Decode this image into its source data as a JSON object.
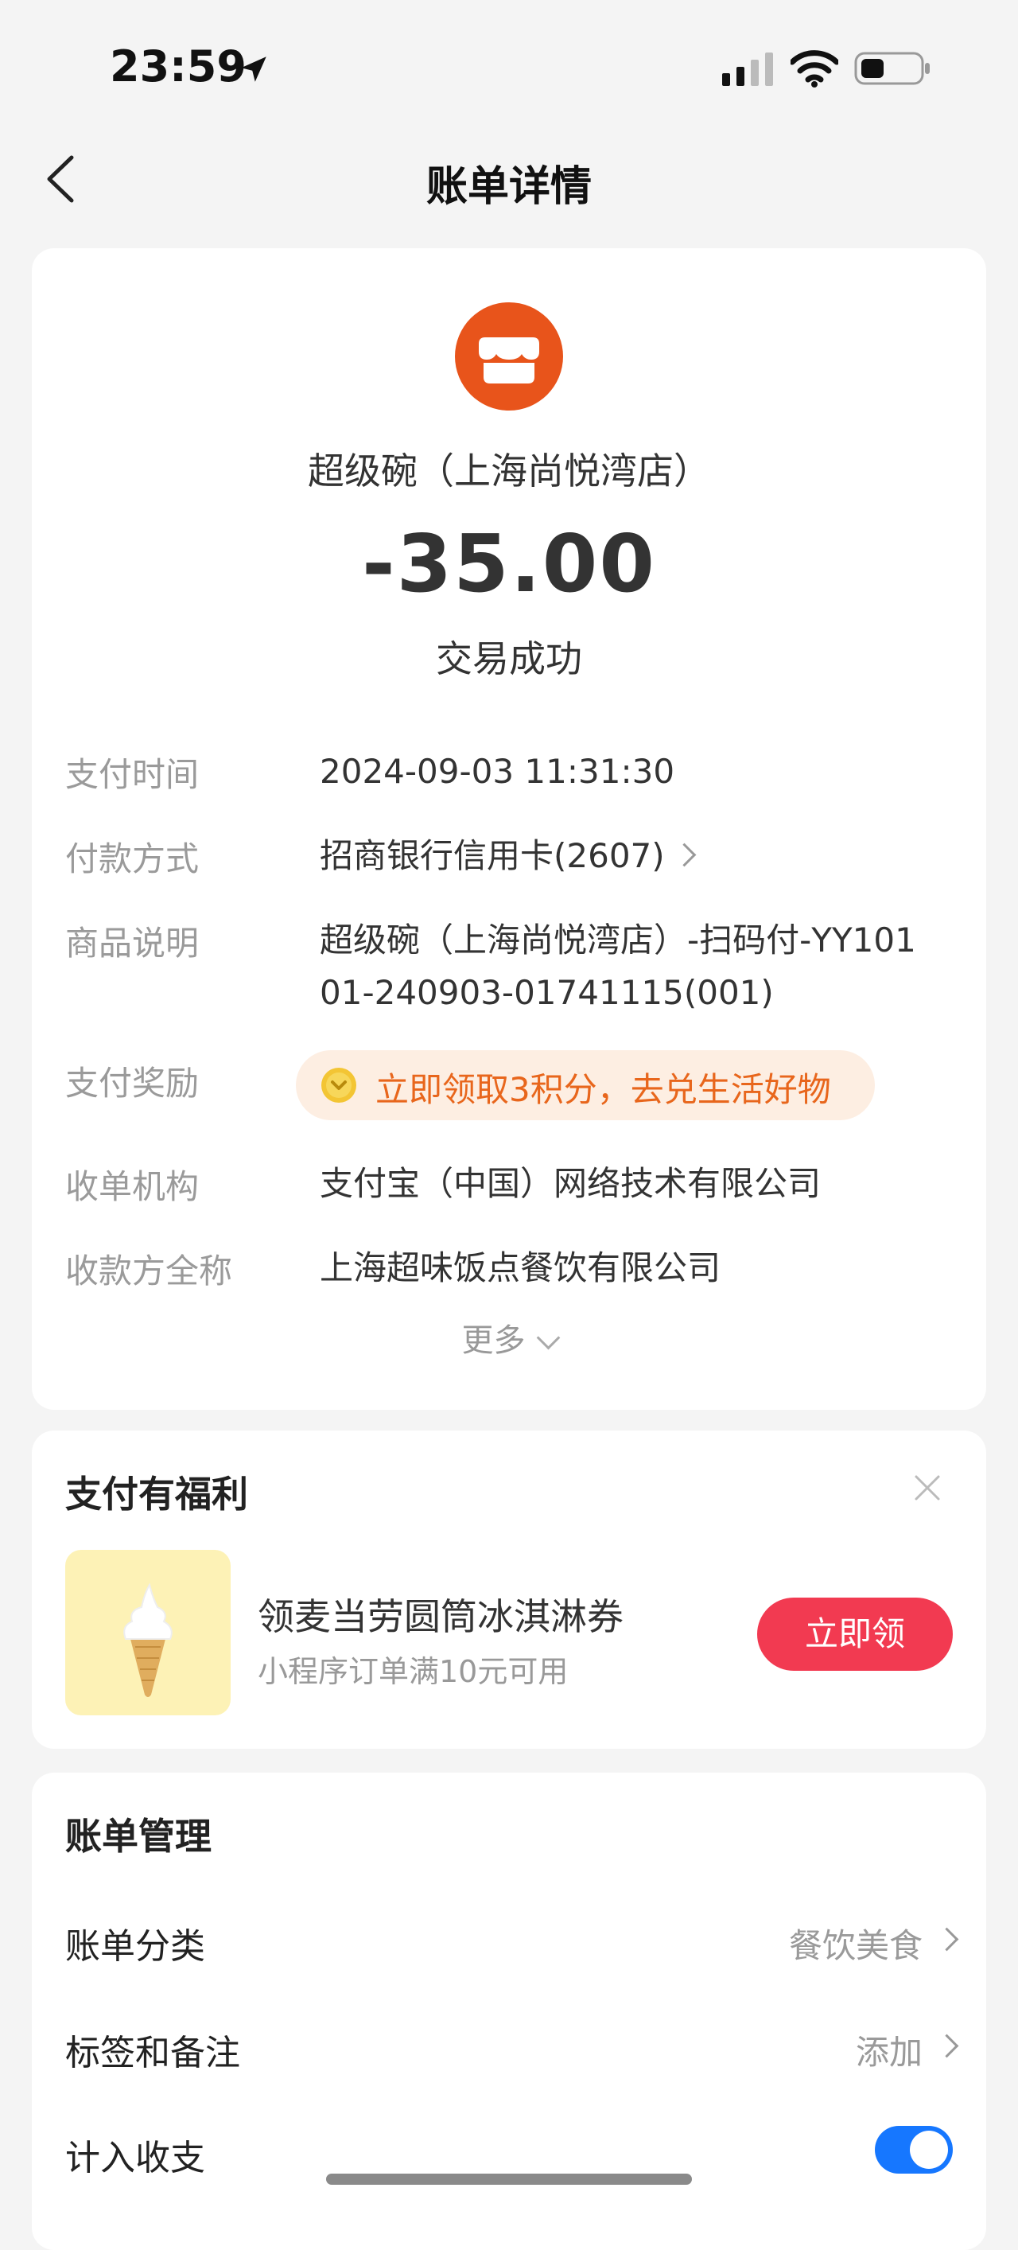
{
  "status_bar": {
    "time": "23:59"
  },
  "nav": {
    "title": "账单详情"
  },
  "bill": {
    "merchant": "超级碗（上海尚悦湾店）",
    "amount": "-35.00",
    "status": "交易成功",
    "rows": [
      {
        "label": "支付时间",
        "value": "2024-09-03 11:31:30"
      },
      {
        "label": "付款方式",
        "value": "招商银行信用卡(2607)"
      },
      {
        "label": "商品说明",
        "value_line1": "超级碗（上海尚悦湾店）-扫码付-YY101",
        "value_line2": "01-240903-01741115(001)"
      },
      {
        "label": "支付奖励",
        "value": "立即领取3积分，去兑生活好物"
      },
      {
        "label": "收单机构",
        "value": "支付宝（中国）网络技术有限公司"
      },
      {
        "label": "收款方全称",
        "value": "上海超味饭点餐饮有限公司"
      }
    ],
    "more_label": "更多"
  },
  "benefit": {
    "title": "支付有福利",
    "promo_title": "领麦当劳圆筒冰淇淋券",
    "promo_sub": "小程序订单满10元可用",
    "claim_label": "立即领"
  },
  "management": {
    "title": "账单管理",
    "items": [
      {
        "label": "账单分类",
        "value": "餐饮美食"
      },
      {
        "label": "标签和备注",
        "value": "添加"
      },
      {
        "label": "计入收支",
        "toggle_on": true
      }
    ]
  },
  "colors": {
    "shop_icon": "#e8541b",
    "reward_text": "#e8661c",
    "claim_button": "#f23a51",
    "toggle": "#1677ff"
  }
}
